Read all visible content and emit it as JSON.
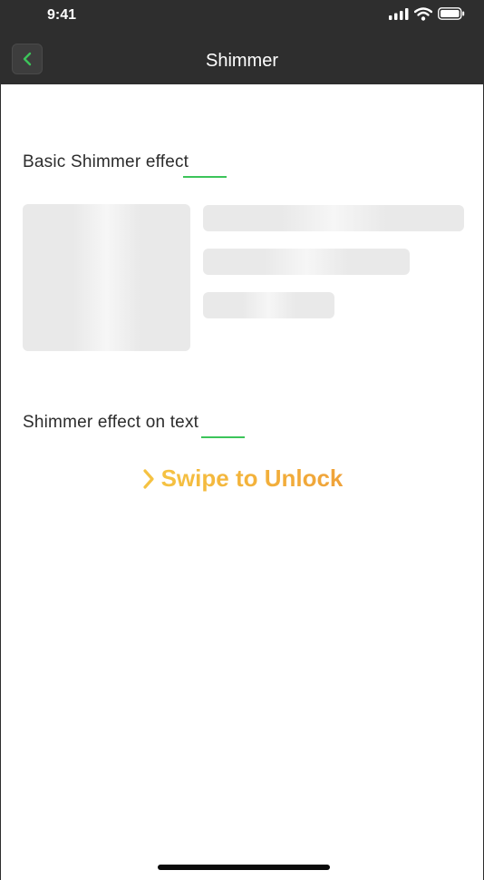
{
  "status_bar": {
    "time": "9:41",
    "icons": [
      "signal-icon",
      "wifi-icon",
      "battery-icon"
    ]
  },
  "nav": {
    "title": "Shimmer",
    "back_icon": "chevron-left-icon"
  },
  "sections": {
    "basic": {
      "title": "Basic Shimmer effect"
    },
    "text": {
      "title": "Shimmer effect on text"
    }
  },
  "swipe": {
    "icon": "chevron-right-icon",
    "label": "Swipe to Unlock"
  },
  "colors": {
    "header_bg": "#2e2e2e",
    "accent_green": "#3cc45a",
    "shimmer_base": "#e9e9e9",
    "shimmer_highlight": "#f6f6f6",
    "swipe_yellow": "#f5c242",
    "swipe_orange": "#efa23a"
  }
}
